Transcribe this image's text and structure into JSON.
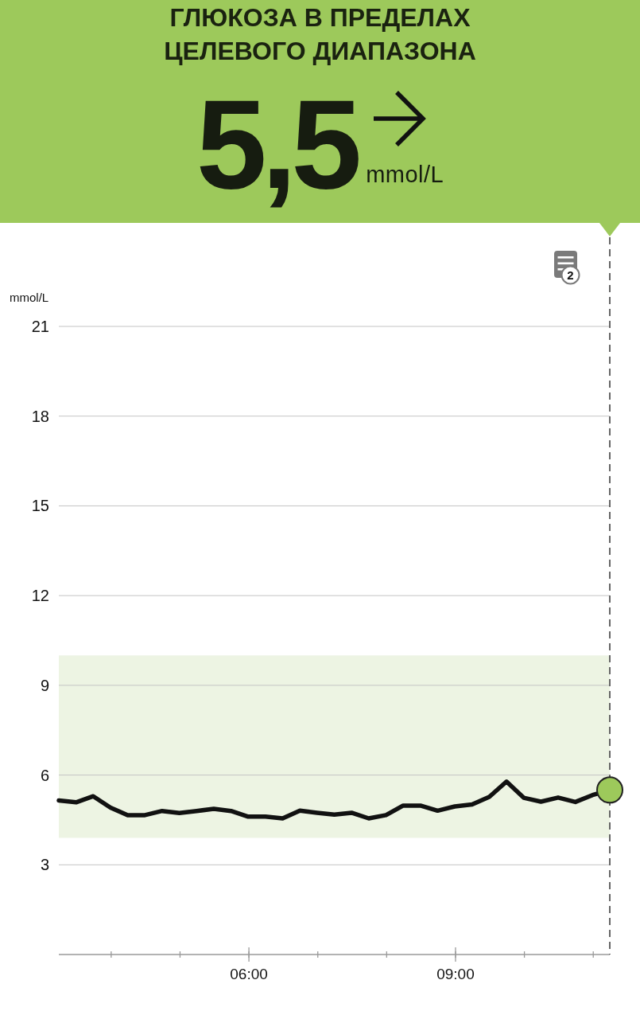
{
  "header": {
    "kind": "in_range",
    "title": "ГЛЮКОЗА В ПРЕДЕЛАХ ЦЕЛЕВОГО ДИАПАЗОНА",
    "value": "5,5",
    "trend": {
      "kind": "flat"
    },
    "unit": "mmol/L"
  },
  "notes": {
    "count": "2"
  },
  "chart": {
    "chart_data": {
      "type": "line",
      "ylabel": "mmol/L",
      "x": [
        3.24,
        3.49,
        3.74,
        3.99,
        4.24,
        4.49,
        4.74,
        4.99,
        5.24,
        5.49,
        5.74,
        5.99,
        6.24,
        6.49,
        6.74,
        6.99,
        7.24,
        7.49,
        7.74,
        7.99,
        8.24,
        8.49,
        8.74,
        8.99,
        9.24,
        9.49,
        9.74,
        9.99,
        10.24,
        10.49,
        10.74,
        10.99,
        11.24
      ],
      "series": [
        {
          "color": "#111111",
          "values": [
            5.15,
            5.09,
            5.29,
            4.91,
            4.66,
            4.66,
            4.8,
            4.73,
            4.8,
            4.87,
            4.8,
            4.61,
            4.61,
            4.55,
            4.81,
            4.74,
            4.68,
            4.74,
            4.55,
            4.66,
            4.98,
            4.98,
            4.81,
            4.95,
            5.02,
            5.27,
            5.78,
            5.24,
            5.11,
            5.25,
            5.1,
            5.33,
            5.5
          ]
        }
      ],
      "xlim": [
        3.24,
        11.24
      ],
      "ylim": [
        0,
        21
      ],
      "xticks": [
        {
          "value": 6,
          "label": "06:00"
        },
        {
          "value": 9,
          "label": "09:00"
        }
      ],
      "yticks": [
        3,
        6,
        9,
        12,
        15,
        18,
        21
      ],
      "grid": true,
      "bands": [
        {
          "axis": "y",
          "from": 3.9,
          "to": 10
        }
      ]
    }
  }
}
